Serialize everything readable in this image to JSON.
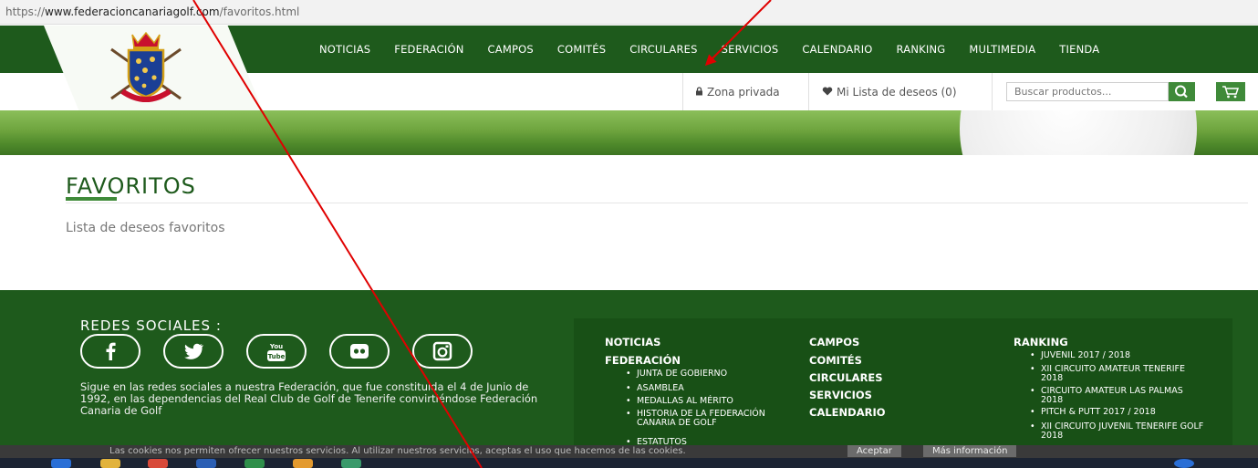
{
  "browser": {
    "url_prefix": "https://",
    "url_host": "www.federacioncanariagolf.com",
    "url_path": "/favoritos.html"
  },
  "nav": {
    "items": [
      "NOTICIAS",
      "FEDERACIÓN",
      "CAMPOS",
      "COMITÉS",
      "CIRCULARES",
      "SERVICIOS",
      "CALENDARIO",
      "RANKING",
      "MULTIMEDIA",
      "TIENDA"
    ]
  },
  "util": {
    "private_zone": "Zona privada",
    "wishlist": "Mi Lista de deseos (0)",
    "search_placeholder": "Buscar productos..."
  },
  "page": {
    "title": "FAVORITOS",
    "subtitle": "Lista de deseos favoritos"
  },
  "footer": {
    "social_heading": "REDES SOCIALES :",
    "social_icons": [
      "facebook-icon",
      "twitter-icon",
      "youtube-icon",
      "flickr-icon",
      "instagram-icon"
    ],
    "about_text": "Sigue en las redes sociales a nuestra Federación, que fue constituida el 4 de Junio de 1992, en las dependencias del Real Club de Golf de Tenerife convirtiéndose Federación Canaria de Golf",
    "menu": {
      "col1": {
        "noticias": "NOTICIAS",
        "federacion": "FEDERACIÓN",
        "sub": [
          "JUNTA DE GOBIERNO",
          "ASAMBLEA",
          "MEDALLAS AL MÉRITO",
          "HISTORIA DE LA FEDERACIÓN CANARIA DE GOLF",
          "ESTATUTOS"
        ]
      },
      "col2": [
        "CAMPOS",
        "COMITÉS",
        "CIRCULARES",
        "SERVICIOS",
        "CALENDARIO"
      ],
      "col3": {
        "ranking": "RANKING",
        "sub": [
          "JUVENIL 2017 / 2018",
          "XII CIRCUITO AMATEUR TENERIFE 2018",
          "CIRCUITO AMATEUR LAS PALMAS 2018",
          "PITCH & PUTT 2017 / 2018",
          "XII CIRCUITO JUVENIL TENERIFE GOLF 2018"
        ]
      }
    }
  },
  "cookies": {
    "text": "Las cookies nos permiten ofrecer nuestros servicios. Al utilizar nuestros servicios, aceptas el uso que hacemos de las cookies.",
    "accept": "Aceptar",
    "more": "Más información"
  },
  "colors": {
    "brand_green": "#1e5a1c",
    "accent_green": "#3f8a39",
    "annotation_red": "#e00000"
  }
}
